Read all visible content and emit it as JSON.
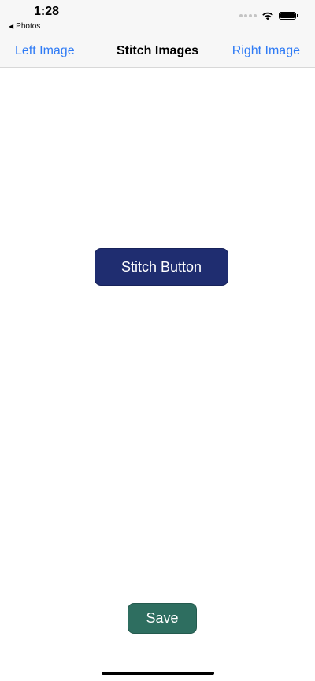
{
  "status_bar": {
    "time": "1:28",
    "back_app_label": "Photos",
    "back_arrow_glyph": "◀",
    "icons": [
      "signal-icon",
      "wifi-icon",
      "battery-icon"
    ]
  },
  "nav_bar": {
    "left_label": "Left Image",
    "title": "Stitch Images",
    "right_label": "Right Image"
  },
  "main": {
    "stitch_button_label": "Stitch Button",
    "save_button_label": "Save"
  },
  "colors": {
    "accent_blue": "#2f7bf5",
    "stitch_button_bg": "#1f2d70",
    "save_button_bg": "#2e6e60"
  }
}
